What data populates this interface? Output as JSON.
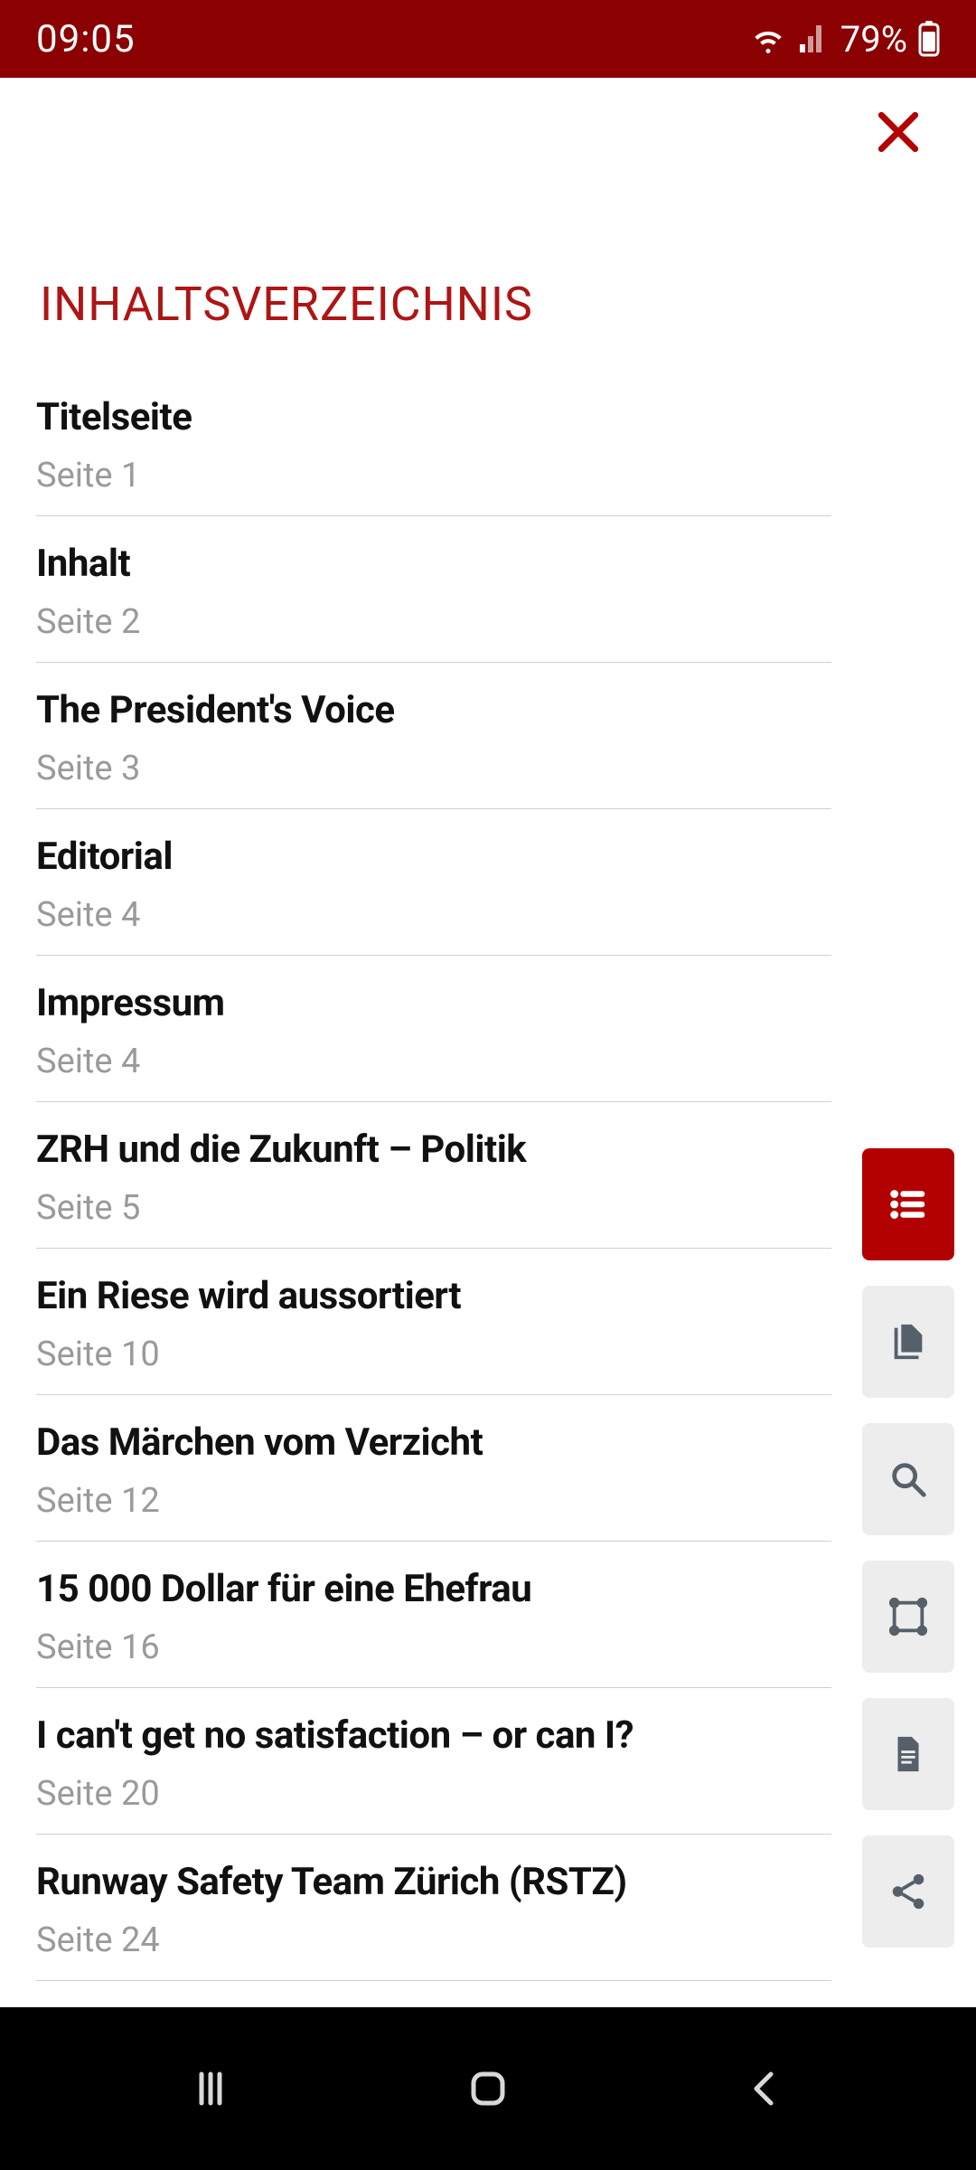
{
  "status": {
    "time": "09:05",
    "battery": "79%"
  },
  "heading": "INHALTSVERZEICHNIS",
  "page_prefix": "Seite",
  "toc": [
    {
      "title": "Titelseite",
      "page": "Seite 1"
    },
    {
      "title": "Inhalt",
      "page": "Seite 2"
    },
    {
      "title": "The President's Voice",
      "page": "Seite 3"
    },
    {
      "title": "Editorial",
      "page": "Seite 4"
    },
    {
      "title": "Impressum",
      "page": "Seite 4"
    },
    {
      "title": "ZRH und die Zukunft – Politik",
      "page": "Seite 5"
    },
    {
      "title": "Ein Riese wird aussortiert",
      "page": "Seite 10"
    },
    {
      "title": "Das Märchen vom Verzicht",
      "page": "Seite 12"
    },
    {
      "title": "15 000 Dollar für eine Ehefrau",
      "page": "Seite 16"
    },
    {
      "title": "I can't get no satisfaction – or can I?",
      "page": "Seite 20"
    },
    {
      "title": "Runway Safety Team Zürich (RSTZ)",
      "page": "Seite 24"
    }
  ],
  "colors": {
    "brand": "#8B0000",
    "accent": "#B30000",
    "heading": "#AE1515",
    "muted": "#9a9a9a"
  }
}
